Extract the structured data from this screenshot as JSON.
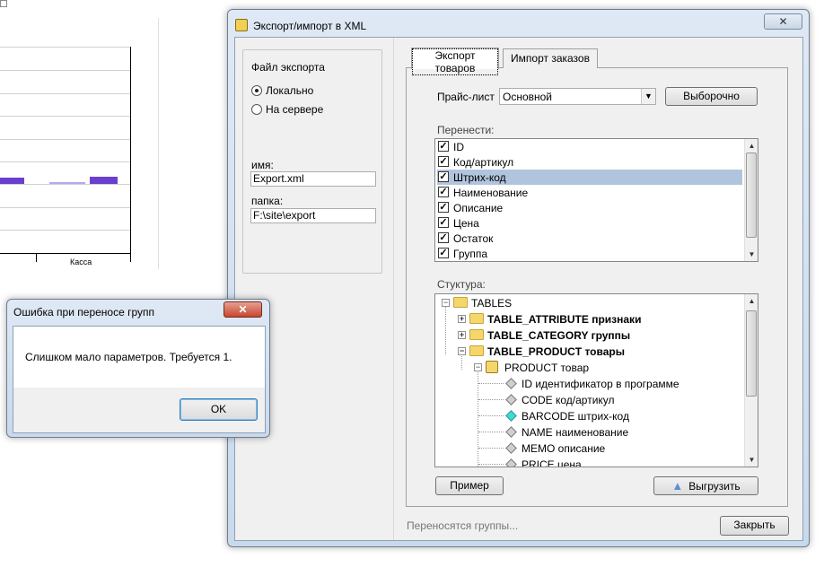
{
  "background_chart": {
    "category_label": "Касса"
  },
  "main_dialog": {
    "title": "Экспорт/импорт в XML",
    "close_label": "✕",
    "export_file": {
      "group_label": "Файл экспорта",
      "radio_local": "Локально",
      "radio_server": "На сервере",
      "name_label": "имя:",
      "name_value": "Export.xml",
      "folder_label": "папка:",
      "folder_value": "F:\\site\\export"
    },
    "tabs": [
      {
        "label": "Экспорт товаров",
        "active": true
      },
      {
        "label": "Импорт заказов",
        "active": false
      }
    ],
    "price_list_label": "Прайс-лист",
    "price_list_value": "Основной",
    "selective_button": "Выборочно",
    "transfer_label": "Перенести:",
    "transfer_items": [
      {
        "label": "ID",
        "checked": true,
        "selected": false
      },
      {
        "label": "Код/артикул",
        "checked": true,
        "selected": false
      },
      {
        "label": "Штрих-код",
        "checked": true,
        "selected": true
      },
      {
        "label": "Наименование",
        "checked": true,
        "selected": false
      },
      {
        "label": "Описание",
        "checked": true,
        "selected": false
      },
      {
        "label": "Цена",
        "checked": true,
        "selected": false
      },
      {
        "label": "Остаток",
        "checked": true,
        "selected": false
      },
      {
        "label": "Группа",
        "checked": true,
        "selected": false
      }
    ],
    "structure_label": "Стуктура:",
    "tree": {
      "root": "TABLES",
      "attribute": "TABLE_ATTRIBUTE признаки",
      "category": "TABLE_CATEGORY группы",
      "product_table": "TABLE_PRODUCT товары",
      "product": "PRODUCT товар",
      "fields": [
        {
          "label": "ID идентификатор в программе",
          "highlight": false
        },
        {
          "label": "CODE код/артикул",
          "highlight": false
        },
        {
          "label": "BARCODE штрих-код",
          "highlight": true
        },
        {
          "label": "NAME наименование",
          "highlight": false
        },
        {
          "label": "MEMO описание",
          "highlight": false
        },
        {
          "label": "PRICE цена",
          "highlight": false
        }
      ]
    },
    "example_button": "Пример",
    "upload_button": "Выгрузить",
    "status_text": "Переносятся группы...",
    "close_button": "Закрыть"
  },
  "error_dialog": {
    "title": "Ошибка при переносе групп",
    "close_label": "✕",
    "message": "Слишком мало параметров. Требуется 1.",
    "ok_button": "OK"
  },
  "colors": {
    "bar": "#6a3fd0",
    "selection": "#b1c4dd",
    "highlight_diamond": "#45d6d6"
  }
}
